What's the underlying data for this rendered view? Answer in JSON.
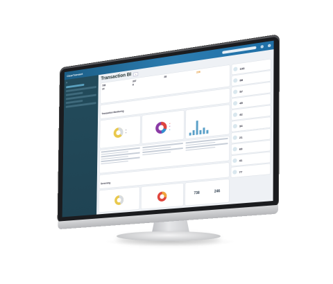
{
  "app": {
    "logo": "ClearTransact"
  },
  "header": {
    "page_title": "Transaction BI"
  },
  "kpis": [
    {
      "value": "795",
      "label": ""
    },
    {
      "value": "307",
      "label": ""
    },
    {
      "value": "28",
      "label": ""
    },
    {
      "value": "14",
      "label": ""
    },
    {
      "value": "8",
      "label": ""
    },
    {
      "value": "226",
      "label": "",
      "accent": "#e08a1a"
    }
  ],
  "colors": {
    "topbar": "#1f6fa6",
    "sidebar": "#234b5b",
    "accent": "#e08a1a"
  },
  "sections": {
    "transaction_monitoring": "Transaction Monitoring",
    "screening": "Screening"
  },
  "counts": {
    "left": {
      "value": "738",
      "sub": ""
    },
    "right": {
      "value": "246",
      "sub": ""
    }
  },
  "right_panel": {
    "items": [
      {
        "value": "193"
      },
      {
        "value": "88"
      },
      {
        "value": "57"
      },
      {
        "value": "45"
      },
      {
        "value": "42"
      },
      {
        "value": "34"
      },
      {
        "value": "21"
      },
      {
        "value": "69"
      },
      {
        "value": "41"
      },
      {
        "value": "77"
      }
    ]
  }
}
